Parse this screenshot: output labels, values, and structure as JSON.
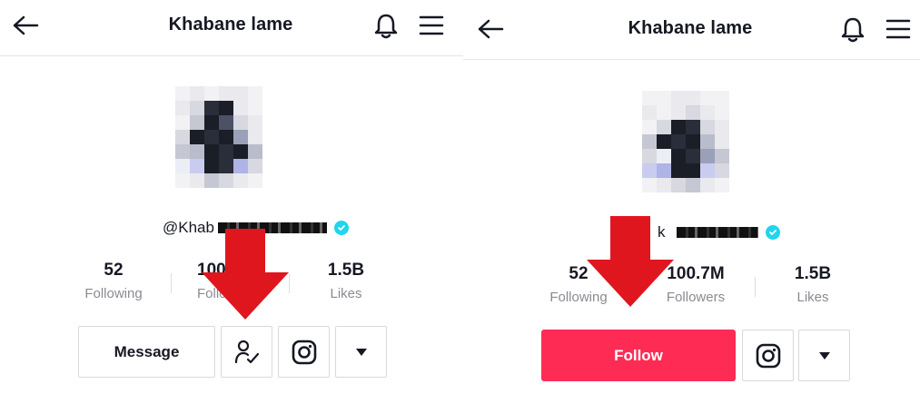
{
  "left": {
    "title": "Khabane lame",
    "username": "@Khab",
    "stats": [
      {
        "value": "52",
        "label": "Following"
      },
      {
        "value": "100",
        "label": "Follo"
      },
      {
        "value": "1.5B",
        "label": "Likes"
      }
    ],
    "message_label": "Message"
  },
  "right": {
    "title": "Khabane lame",
    "username": "k",
    "stats": [
      {
        "value": "52",
        "label": "Following"
      },
      {
        "value": "100.7M",
        "label": "Followers"
      },
      {
        "value": "1.5B",
        "label": "Likes"
      }
    ],
    "follow_label": "Follow"
  },
  "colors": {
    "follow": "#fe2c55",
    "arrow": "#e0161f",
    "verified": "#20d5ec",
    "muted_text": "#8a8b91"
  },
  "icons": [
    "back-arrow-icon",
    "bell-icon",
    "hamburger-menu-icon",
    "user-check-icon",
    "instagram-icon",
    "caret-down-icon",
    "verified-badge-icon",
    "red-down-arrow-annotation"
  ]
}
